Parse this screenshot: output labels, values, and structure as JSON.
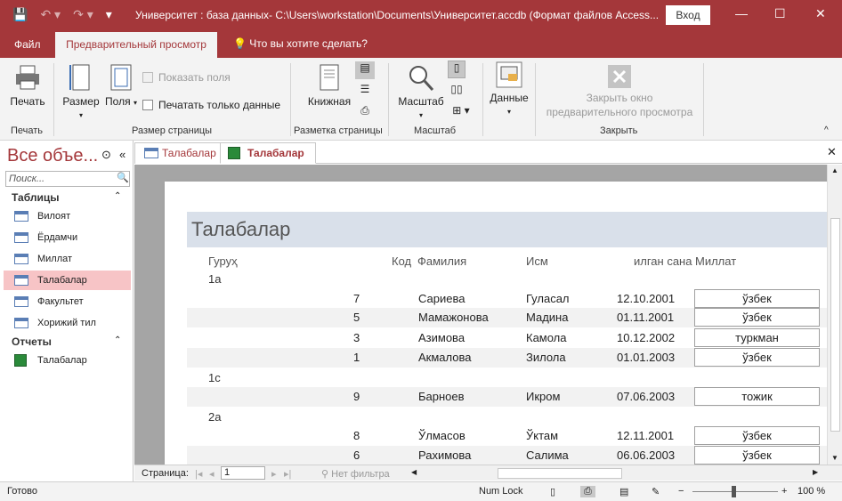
{
  "titlebar": {
    "title": "Университет : база данных- C:\\Users\\workstation\\Documents\\Университет.accdb (Формат файлов Access...",
    "login_label": "Вход",
    "minimize": "—",
    "maximize": "☐",
    "close": "✕"
  },
  "tabs": {
    "file": "Файл",
    "active": "Предварительный просмотр",
    "tell_me": "Что вы хотите сделать?"
  },
  "ribbon": {
    "print": "Печать",
    "size": "Размер",
    "margins": "Поля",
    "show_margins": "Показать поля",
    "print_data_only": "Печатать только данные",
    "portrait": "Книжная",
    "zoom": "Масштаб",
    "data": "Данные",
    "close_preview_line1": "Закрыть окно",
    "close_preview_line2": "предварительного просмотра",
    "groups": {
      "print": "Печать",
      "page_size": "Размер страницы",
      "page_layout": "Разметка страницы",
      "zoom": "Масштаб",
      "close": "Закрыть"
    }
  },
  "nav": {
    "header": "Все объе...",
    "search_placeholder": "Поиск...",
    "tables_section": "Таблицы",
    "reports_section": "Отчеты",
    "tables": [
      "Вилоят",
      "Ёрдамчи",
      "Миллат",
      "Талабалар",
      "Факультет",
      "Хорижий тил"
    ],
    "reports": [
      "Талабалар"
    ],
    "selected": "Талабалар"
  },
  "doc_tabs": [
    "Талабалар",
    "Талабалар"
  ],
  "report": {
    "title": "Талабалар",
    "columns": [
      "Гуруҳ",
      "Код",
      "Фамилия",
      "Исм",
      "илган сана",
      "Миллат"
    ],
    "groups": [
      {
        "name": "1а",
        "rows": [
          {
            "code": "7",
            "surname": "Сариева",
            "name": "Гуласал",
            "date": "12.10.2001",
            "nation": "ўзбек"
          },
          {
            "code": "5",
            "surname": "Мамажонова",
            "name": "Мадина",
            "date": "01.11.2001",
            "nation": "ўзбек"
          },
          {
            "code": "3",
            "surname": "Азимова",
            "name": "Камола",
            "date": "10.12.2002",
            "nation": "туркман"
          },
          {
            "code": "1",
            "surname": "Акмалова",
            "name": "Зилола",
            "date": "01.01.2003",
            "nation": "ўзбек"
          }
        ]
      },
      {
        "name": "1с",
        "rows": [
          {
            "code": "9",
            "surname": "Барноев",
            "name": "Икром",
            "date": "07.06.2003",
            "nation": "тожик"
          }
        ]
      },
      {
        "name": "2а",
        "rows": [
          {
            "code": "8",
            "surname": "Ўлмасов",
            "name": "Ўктам",
            "date": "12.11.2001",
            "nation": "ўзбек"
          },
          {
            "code": "6",
            "surname": "Рахимова",
            "name": "Салима",
            "date": "06.06.2003",
            "nation": "ўзбек"
          }
        ]
      }
    ]
  },
  "pager": {
    "label": "Страница:",
    "value": "1",
    "filter": "Нет фильтра"
  },
  "status": {
    "ready": "Готово",
    "numlock": "Num Lock",
    "zoom": "100 %"
  }
}
